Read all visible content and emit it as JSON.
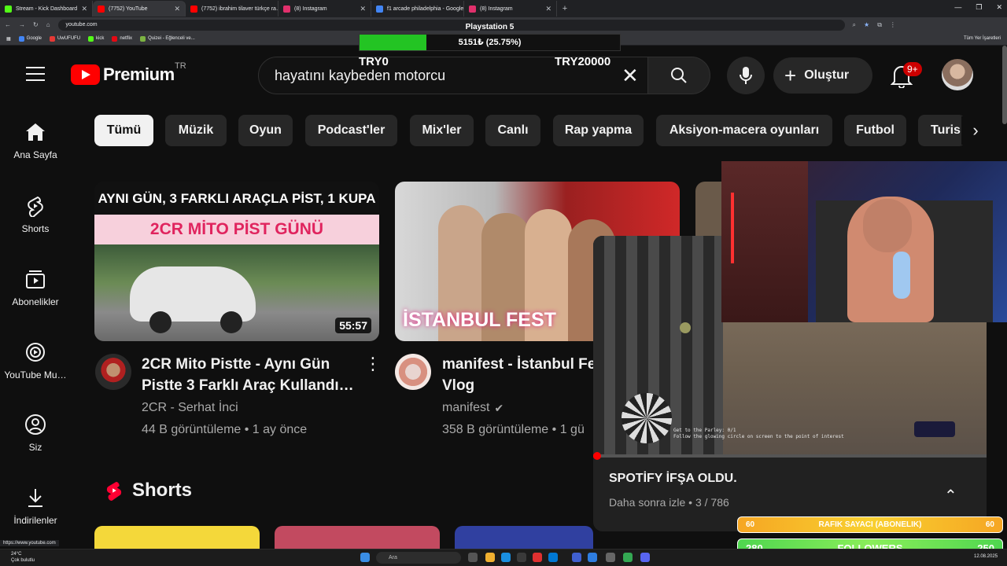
{
  "browser": {
    "tabs": [
      {
        "title": "Stream - Kick Dashboard",
        "color": "#53fc18"
      },
      {
        "title": "(7752) YouTube",
        "color": "#ff0000"
      },
      {
        "title": "(7752) ibrahim tilaver türkçe ra…",
        "color": "#ff0000"
      },
      {
        "title": "(8) Instagram",
        "color": "#e1306c"
      },
      {
        "title": "f1 arcade philadelphia - Google",
        "color": "#4285f4"
      },
      {
        "title": "(8) Instagram",
        "color": "#e1306c"
      }
    ],
    "url": "youtube.com",
    "bookmarks": [
      {
        "label": "Google",
        "color": "#4285f4"
      },
      {
        "label": "UwUFUFU",
        "color": "#e53935"
      },
      {
        "label": "kick",
        "color": "#53fc18"
      },
      {
        "label": "netflix",
        "color": "#e50914"
      },
      {
        "label": "Quizei - Eğlenceli ve...",
        "color": "#7cb342"
      }
    ],
    "all_bookmarks": "Tüm Yer İşaretleri",
    "status_url": "https://www.youtube.com"
  },
  "overlay": {
    "goal_title": "Playstation 5",
    "goal_text": "5151₺ (25.75%)",
    "goal_progress": 0.2575,
    "min_label": "TRY0",
    "max_label": "TRY20000",
    "subs_label": "RAFIK SAYACI (ABONELIK)",
    "subs_left": "60",
    "subs_right": "60",
    "followers_label": "FOLLOWERS",
    "followers_left": "280",
    "followers_right": "250"
  },
  "header": {
    "logo_text": "Premium",
    "region": "TR",
    "search_value": "hayatını kaybeden motorcu",
    "create_label": "Oluştur",
    "notification_count": "9+"
  },
  "sidebar": [
    {
      "label": "Ana Sayfa",
      "icon": "home-icon"
    },
    {
      "label": "Shorts",
      "icon": "shorts-icon"
    },
    {
      "label": "Abonelikler",
      "icon": "subscriptions-icon"
    },
    {
      "label": "YouTube Mu…",
      "icon": "youtube-music-icon"
    },
    {
      "label": "Siz",
      "icon": "you-icon"
    },
    {
      "label": "İndirilenler",
      "icon": "downloads-icon"
    }
  ],
  "chips": [
    "Tümü",
    "Müzik",
    "Oyun",
    "Podcast'ler",
    "Mix'ler",
    "Canlı",
    "Rap yapma",
    "Aksiyon-macera oyunları",
    "Futbol",
    "Turis"
  ],
  "videos": [
    {
      "thumb_line1": "AYNI GÜN, 3 FARKLI ARAÇLA PİST, 1 KUPA",
      "thumb_line2": "2CR MİTO PİST GÜNÜ",
      "duration": "55:57",
      "title_line1": "2CR Mito Pistte - Aynı Gün",
      "title_line2": "Pistte 3 Farklı Araç Kullandı…",
      "channel": "2CR - Serhat İnci",
      "meta": "44 B görüntüleme • 1 ay önce"
    },
    {
      "thumb_text": "İSTANBUL FEST",
      "title_line1": "manifest - İstanbul Fe",
      "title_line2": "Vlog",
      "channel": "manifest",
      "meta": "358 B görüntüleme • 1 gü"
    }
  ],
  "shorts": {
    "title": "Shorts"
  },
  "miniplayer": {
    "title": "SPOTİFY İFŞA OLDU.",
    "subtitle": "Daha sonra izle • 3 / 786",
    "hud_line1": "Get to the Parley: 0/1",
    "hud_line2": "Follow the glowing circle on screen to the point of interest",
    "progress": 0.01
  },
  "taskbar": {
    "weather_temp": "24°C",
    "weather_desc": "Çok bulutlu",
    "search_placeholder": "Ara",
    "date": "12.08.2025"
  }
}
